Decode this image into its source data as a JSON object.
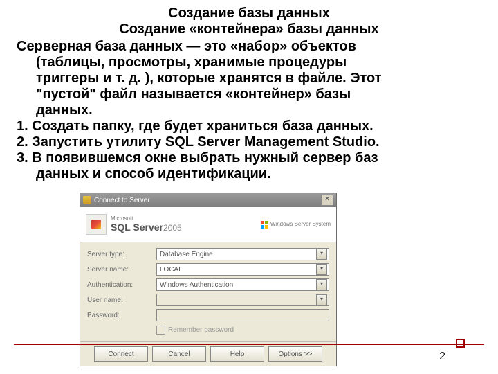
{
  "slide": {
    "title": "Создание базы данных",
    "subtitle": "Создание «контейнера» базы данных",
    "para_line1": "Серверная база данных — это «набор» объектов",
    "para_line2": "(таблицы, просмотры, хранимые процедуры",
    "para_line3": "триггеры и т. д. ), которые хранятся в файле. Этот",
    "para_line4": "\"пустой\" файл называется «контейнер» базы",
    "para_line5": "данных.",
    "step1": "1. Создать папку, где будет храниться база данных.",
    "step2": "2. Запустить утилиту SQL Server Management Studio.",
    "step3a": "3. В появившемся окне выбрать нужный сервер баз",
    "step3b": "данных и способ идентификации.",
    "page_number": "2"
  },
  "dialog": {
    "title": "Connect to Server",
    "close": "×",
    "brand_small": "Microsoft",
    "brand_main": "SQL Server",
    "brand_year": "2005",
    "ws_line1": "Windows Server System",
    "fields": {
      "server_type": {
        "label": "Server type:",
        "value": "Database Engine"
      },
      "server_name": {
        "label": "Server name:",
        "value": "LOCAL"
      },
      "authentication": {
        "label": "Authentication:",
        "value": "Windows Authentication"
      },
      "user_name": {
        "label": "User name:",
        "value": ""
      },
      "password": {
        "label": "Password:",
        "value": ""
      }
    },
    "remember": "Remember password",
    "buttons": {
      "connect": "Connect",
      "cancel": "Cancel",
      "help": "Help",
      "options": "Options >>"
    }
  }
}
